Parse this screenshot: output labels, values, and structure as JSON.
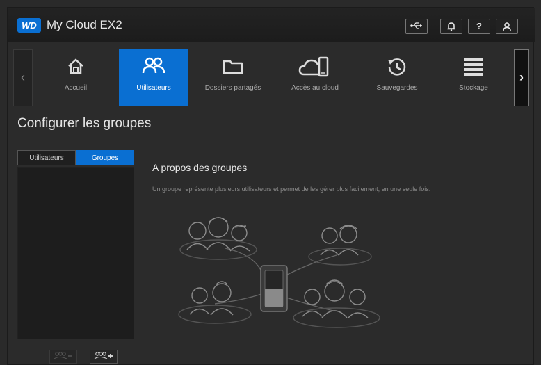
{
  "header": {
    "logo": "WD",
    "product_name": "My Cloud EX2",
    "help_label": "?"
  },
  "nav": {
    "items": [
      {
        "label": "Accueil",
        "icon": "home-icon"
      },
      {
        "label": "Utilisateurs",
        "icon": "users-icon",
        "active": true
      },
      {
        "label": "Dossiers partagés",
        "icon": "folder-icon"
      },
      {
        "label": "Accès au cloud",
        "icon": "cloud-devices-icon"
      },
      {
        "label": "Sauvegardes",
        "icon": "history-icon"
      },
      {
        "label": "Stockage",
        "icon": "storage-icon"
      }
    ],
    "prev": "‹",
    "next": "›"
  },
  "page": {
    "title": "Configurer les groupes"
  },
  "tabs": {
    "users": "Utilisateurs",
    "groups": "Groupes"
  },
  "about": {
    "title": "A propos des groupes",
    "description": "Un groupe représente plusieurs utilisateurs et permet de les gérer plus facilement, en une seule fois."
  },
  "colors": {
    "accent": "#0a6fd2",
    "background": "#2b2b2b"
  }
}
